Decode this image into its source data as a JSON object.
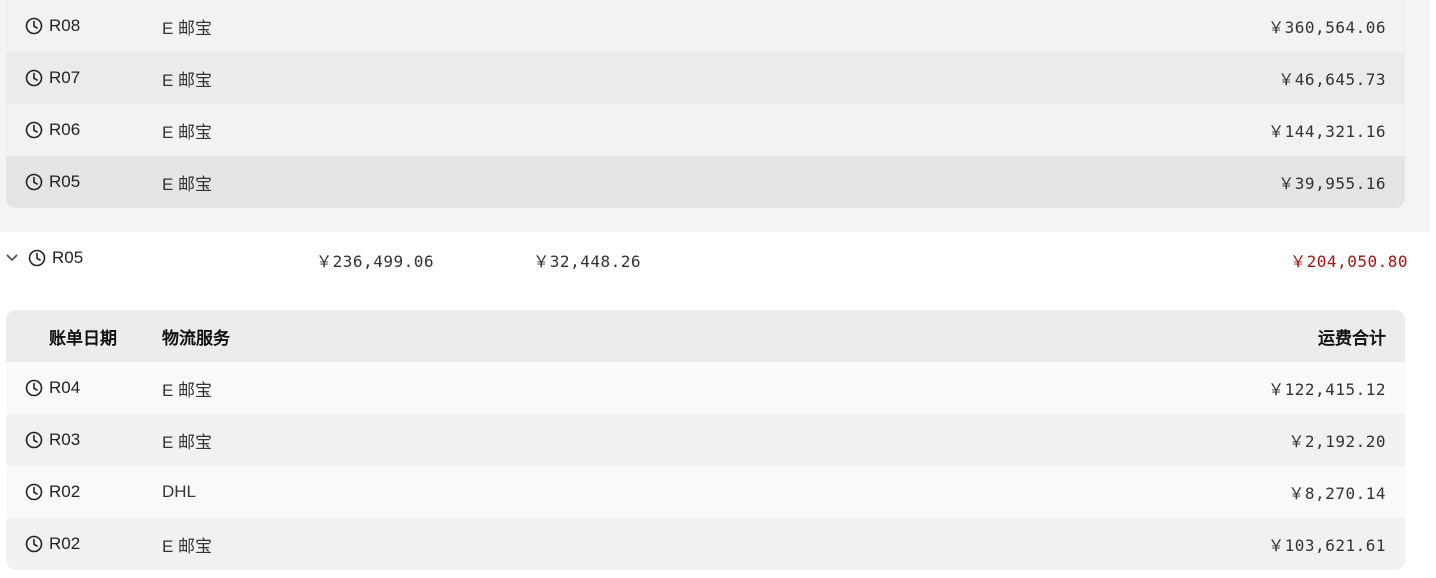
{
  "colors": {
    "net_positive": "#a31515"
  },
  "previous_group_rows": [
    {
      "date": "R08",
      "service": "E 邮宝",
      "freight": "￥360,564.06"
    },
    {
      "date": "R07",
      "service": "E 邮宝",
      "freight": "￥46,645.73"
    },
    {
      "date": "R06",
      "service": "E 邮宝",
      "freight": "￥144,321.16"
    },
    {
      "date": "R05",
      "service": "E 邮宝",
      "freight": "￥39,955.16"
    }
  ],
  "group": {
    "label": "R05",
    "total": "￥236,499.06",
    "cost": "￥32,448.26",
    "net": "￥204,050.80"
  },
  "table_headers": {
    "date": "账单日期",
    "service": "物流服务",
    "freight": "运费合计"
  },
  "group_rows": [
    {
      "date": "R04",
      "service": "E 邮宝",
      "freight": "￥122,415.12"
    },
    {
      "date": "R03",
      "service": "E 邮宝",
      "freight": "￥2,192.20"
    },
    {
      "date": "R02",
      "service": "DHL",
      "freight": "￥8,270.14"
    },
    {
      "date": "R02",
      "service": "E 邮宝",
      "freight": "￥103,621.61"
    }
  ]
}
